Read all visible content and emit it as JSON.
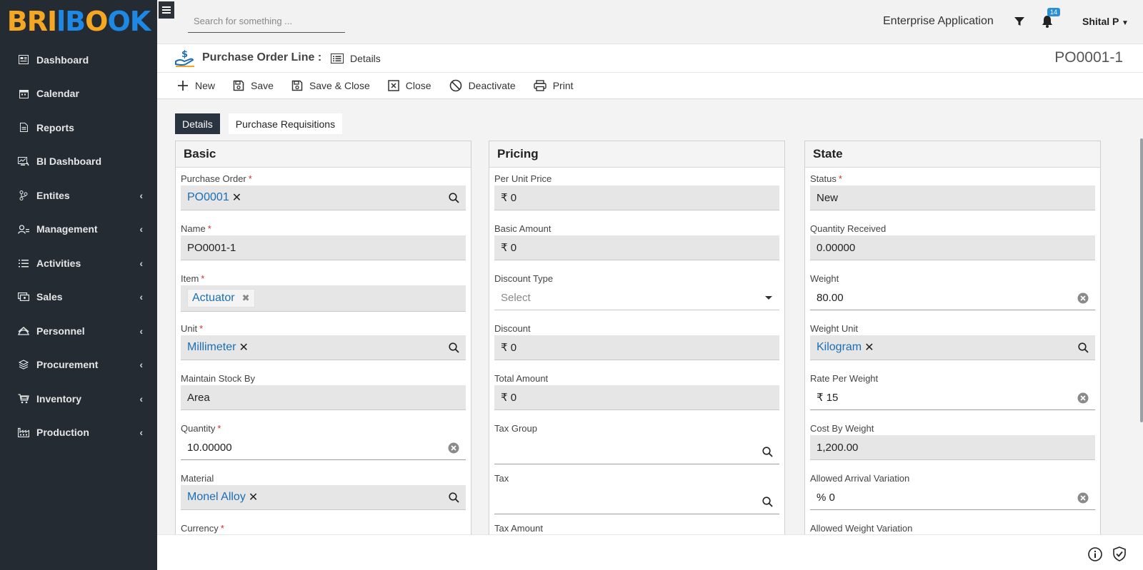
{
  "logo": {
    "part1": "BRI",
    "part2": "lB",
    "part3": "O",
    "part4": "OK"
  },
  "sidebar": {
    "items": [
      {
        "label": "Dashboard",
        "icon": "dashboard-icon",
        "has_children": false
      },
      {
        "label": "Calendar",
        "icon": "calendar-icon",
        "has_children": false
      },
      {
        "label": "Reports",
        "icon": "reports-icon",
        "has_children": false
      },
      {
        "label": "BI Dashboard",
        "icon": "chart-icon",
        "has_children": false
      },
      {
        "label": "Entites",
        "icon": "branch-icon",
        "has_children": true
      },
      {
        "label": "Management",
        "icon": "users-icon",
        "has_children": true
      },
      {
        "label": "Activities",
        "icon": "list-icon",
        "has_children": true
      },
      {
        "label": "Sales",
        "icon": "money-icon",
        "has_children": true
      },
      {
        "label": "Personnel",
        "icon": "personnel-icon",
        "has_children": true
      },
      {
        "label": "Procurement",
        "icon": "layers-icon",
        "has_children": true
      },
      {
        "label": "Inventory",
        "icon": "cart-icon",
        "has_children": true
      },
      {
        "label": "Production",
        "icon": "factory-icon",
        "has_children": true
      }
    ]
  },
  "topbar": {
    "search_placeholder": "Search for something ...",
    "app_name": "Enterprise Application",
    "notifications_count": "14",
    "user_name": "Shital P"
  },
  "title": {
    "main": "Purchase Order Line :",
    "sub": "Details",
    "record_id": "PO0001-1"
  },
  "toolbar": {
    "new": "New",
    "save": "Save",
    "save_close": "Save & Close",
    "close": "Close",
    "deactivate": "Deactivate",
    "print": "Print"
  },
  "tabs": [
    "Details",
    "Purchase Requisitions"
  ],
  "basic": {
    "heading": "Basic",
    "purchase_order": {
      "label": "Purchase Order",
      "value": "PO0001"
    },
    "name": {
      "label": "Name",
      "value": "PO0001-1"
    },
    "item": {
      "label": "Item",
      "value": "Actuator"
    },
    "unit": {
      "label": "Unit",
      "value": "Millimeter"
    },
    "maintain_stock_by": {
      "label": "Maintain Stock By",
      "value": "Area"
    },
    "quantity": {
      "label": "Quantity",
      "value": "10.00000"
    },
    "material": {
      "label": "Material",
      "value": "Monel Alloy"
    },
    "currency": {
      "label": "Currency"
    }
  },
  "pricing": {
    "heading": "Pricing",
    "per_unit_price": {
      "label": "Per Unit Price",
      "value": "₹ 0"
    },
    "basic_amount": {
      "label": "Basic Amount",
      "value": "₹ 0"
    },
    "discount_type": {
      "label": "Discount Type",
      "placeholder": "Select"
    },
    "discount": {
      "label": "Discount",
      "value": "₹ 0"
    },
    "total_amount": {
      "label": "Total Amount",
      "value": "₹ 0"
    },
    "tax_group": {
      "label": "Tax Group",
      "value": ""
    },
    "tax": {
      "label": "Tax",
      "value": ""
    },
    "tax_amount": {
      "label": "Tax Amount"
    }
  },
  "state": {
    "heading": "State",
    "status": {
      "label": "Status",
      "value": "New"
    },
    "quantity_received": {
      "label": "Quantity Received",
      "value": "0.00000"
    },
    "weight": {
      "label": "Weight",
      "value": "80.00"
    },
    "weight_unit": {
      "label": "Weight Unit",
      "value": "Kilogram"
    },
    "rate_per_weight": {
      "label": "Rate Per Weight",
      "value": "₹ 15"
    },
    "cost_by_weight": {
      "label": "Cost By Weight",
      "value": "1,200.00"
    },
    "allowed_arrival_variation": {
      "label": "Allowed Arrival Variation",
      "value": "% 0"
    },
    "allowed_weight_variation": {
      "label": "Allowed Weight Variation"
    }
  },
  "colors": {
    "sidebar_bg": "#252b33",
    "link": "#1a6fb5",
    "required": "#d32f2f",
    "tab_active": "#2a3340",
    "badge": "#2a8fd6"
  }
}
